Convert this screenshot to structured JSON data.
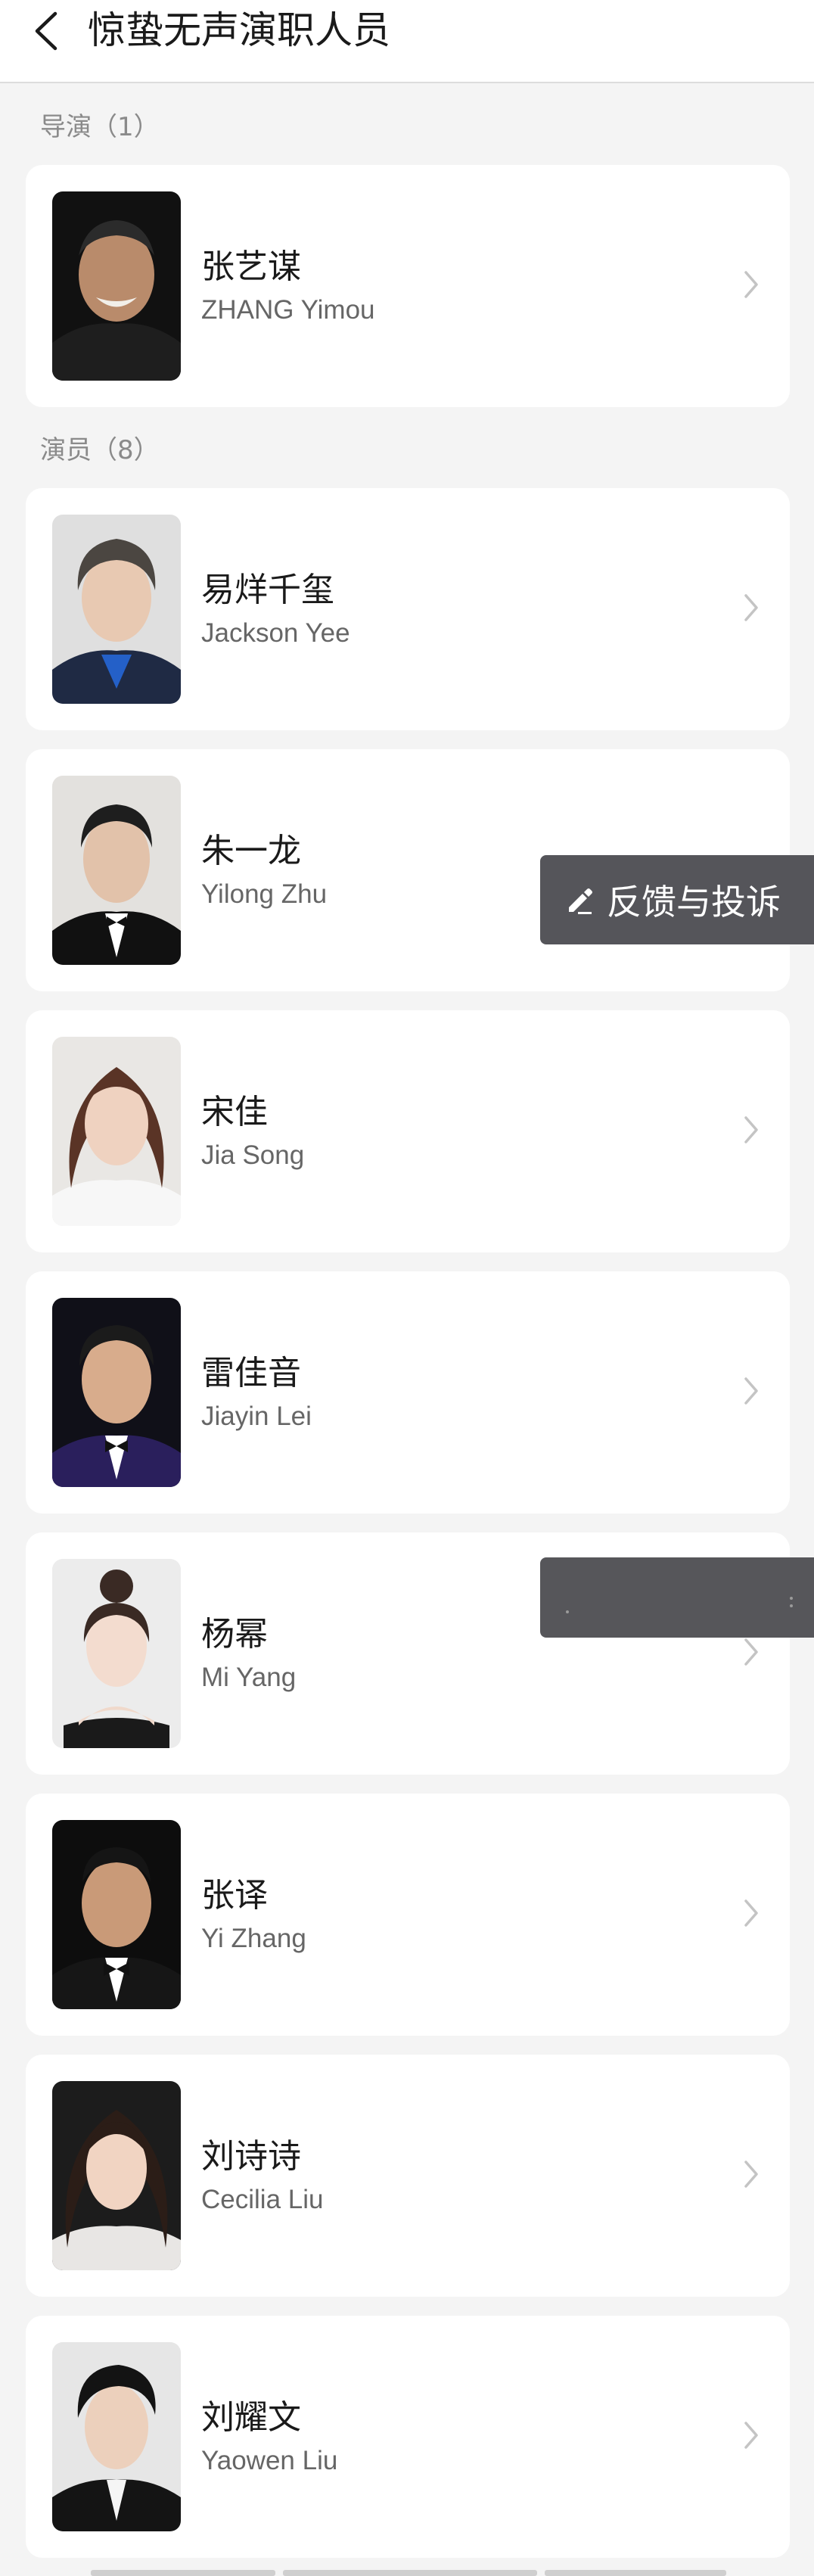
{
  "header": {
    "title": "惊蛰无声演职人员"
  },
  "sections": {
    "director_label": "导演（1）",
    "cast_label": "演员（8）"
  },
  "people": [
    {
      "name": "张艺谋",
      "en_name": "ZHANG Yimou"
    },
    {
      "name": "易烊千玺",
      "en_name": "Jackson Yee"
    },
    {
      "name": "朱一龙",
      "en_name": "Yilong Zhu"
    },
    {
      "name": "宋佳",
      "en_name": "Jia Song"
    },
    {
      "name": "雷佳音",
      "en_name": "Jiayin Lei"
    },
    {
      "name": "杨幂",
      "en_name": "Mi Yang"
    },
    {
      "name": "张译",
      "en_name": "Yi Zhang"
    },
    {
      "name": "刘诗诗",
      "en_name": "Cecilia Liu"
    },
    {
      "name": "刘耀文",
      "en_name": "Yaowen Liu"
    }
  ],
  "feedback": {
    "label": "反馈与投诉",
    "icon": "pencil-edit-icon"
  },
  "icons": {
    "back": "chevron-left-icon",
    "row_arrow": "chevron-right-icon"
  },
  "colors": {
    "background": "#f4f4f4",
    "card": "#ffffff",
    "primary_text": "#1a1a1a",
    "secondary_text": "#666666",
    "section_text": "#8a8a8a",
    "floating_button": "#55555a"
  }
}
